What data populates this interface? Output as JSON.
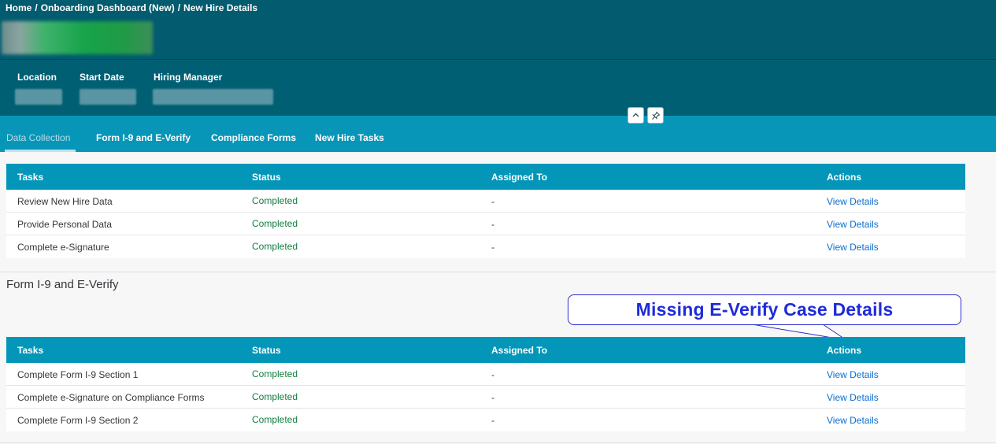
{
  "breadcrumb": {
    "home": "Home",
    "sep1": "/",
    "dashboard": "Onboarding Dashboard (New)",
    "sep2": "/",
    "current": "New Hire Details"
  },
  "header": {
    "attributes": [
      {
        "label": "Location"
      },
      {
        "label": "Start Date"
      },
      {
        "label": "Hiring Manager"
      }
    ]
  },
  "tabs": [
    {
      "label": "Data Collection",
      "active": true
    },
    {
      "label": "Form I-9 and E-Verify"
    },
    {
      "label": "Compliance Forms"
    },
    {
      "label": "New Hire Tasks"
    }
  ],
  "data_collection": {
    "columns": {
      "tasks": "Tasks",
      "status": "Status",
      "assigned": "Assigned To",
      "actions": "Actions"
    },
    "rows": [
      {
        "task": "Review New Hire Data",
        "status": "Completed",
        "assigned": "-",
        "action": "View Details"
      },
      {
        "task": "Provide Personal Data",
        "status": "Completed",
        "assigned": "-",
        "action": "View Details"
      },
      {
        "task": "Complete e-Signature",
        "status": "Completed",
        "assigned": "-",
        "action": "View Details"
      }
    ]
  },
  "i9_section": {
    "title": "Form I-9 and E-Verify",
    "columns": {
      "tasks": "Tasks",
      "status": "Status",
      "assigned": "Assigned To",
      "actions": "Actions"
    },
    "rows": [
      {
        "task": "Complete Form I-9 Section 1",
        "status": "Completed",
        "assigned": "-",
        "action": "View Details"
      },
      {
        "task": "Complete e-Signature on Compliance Forms",
        "status": "Completed",
        "assigned": "-",
        "action": "View Details"
      },
      {
        "task": "Complete Form I-9 Section 2",
        "status": "Completed",
        "assigned": "-",
        "action": "View Details"
      }
    ]
  },
  "annotation": {
    "text": "Missing E-Verify Case Details"
  },
  "colors": {
    "header": "#005f73",
    "tabbar": "#0796b8",
    "table_header": "#0396b8",
    "status_ok": "#107e3e",
    "link": "#0a6ed1",
    "callout": "#1e2bd9"
  },
  "icons": {
    "collapse": "chevron-up-icon",
    "pin": "pin-icon"
  }
}
